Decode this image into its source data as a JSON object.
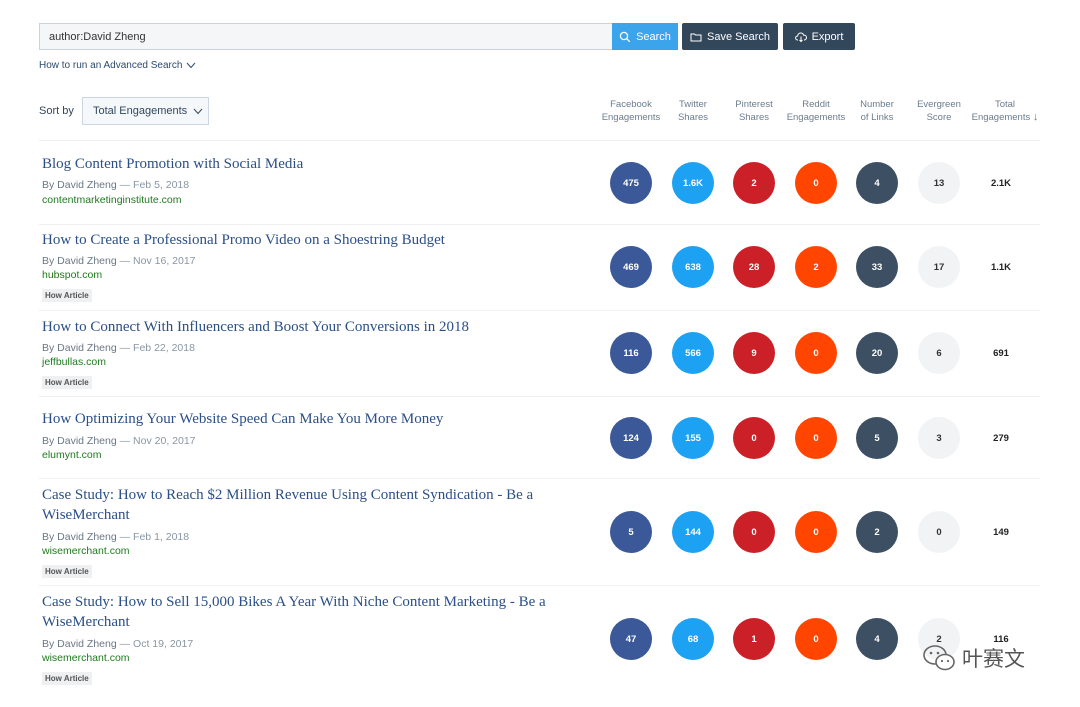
{
  "search": {
    "query": "author:David Zheng",
    "search_label": "Search",
    "save_label": "Save Search",
    "export_label": "Export",
    "advanced_link": "How to run an Advanced Search"
  },
  "sort": {
    "label": "Sort by",
    "selected": "Total Engagements"
  },
  "columns": [
    {
      "line1": "Facebook",
      "line2": "Engagements"
    },
    {
      "line1": "Twitter",
      "line2": "Shares"
    },
    {
      "line1": "Pinterest",
      "line2": "Shares"
    },
    {
      "line1": "Reddit",
      "line2": "Engagements"
    },
    {
      "line1": "Number",
      "line2": "of Links"
    },
    {
      "line1": "Evergreen",
      "line2": "Score"
    },
    {
      "line1": "Total",
      "line2": "Engagements",
      "sort_arrow": "↓"
    }
  ],
  "colors": {
    "facebook": "#3b5998",
    "twitter": "#1da1f2",
    "pinterest": "#cb2027",
    "reddit": "#ff4500",
    "links": "#3d4f63",
    "evergreen": "#f2f3f4"
  },
  "results": [
    {
      "title": "Blog Content Promotion with Social Media",
      "author": "By David Zheng",
      "date": "— Feb 5, 2018",
      "domain": "contentmarketinginstitute.com",
      "tag": "",
      "facebook": "475",
      "twitter": "1.6K",
      "pinterest": "2",
      "reddit": "0",
      "links": "4",
      "evergreen": "13",
      "total": "2.1K"
    },
    {
      "title": "How to Create a Professional Promo Video on a Shoestring Budget",
      "author": "By David Zheng",
      "date": "— Nov 16, 2017",
      "domain": "hubspot.com",
      "tag": "How Article",
      "facebook": "469",
      "twitter": "638",
      "pinterest": "28",
      "reddit": "2",
      "links": "33",
      "evergreen": "17",
      "total": "1.1K"
    },
    {
      "title": "How to Connect With Influencers and Boost Your Conversions in 2018",
      "author": "By David Zheng",
      "date": "— Feb 22, 2018",
      "domain": "jeffbullas.com",
      "tag": "How Article",
      "facebook": "116",
      "twitter": "566",
      "pinterest": "9",
      "reddit": "0",
      "links": "20",
      "evergreen": "6",
      "total": "691"
    },
    {
      "title": "How Optimizing Your Website Speed Can Make You More Money",
      "author": "By David Zheng",
      "date": "— Nov 20, 2017",
      "domain": "elumynt.com",
      "tag": "",
      "facebook": "124",
      "twitter": "155",
      "pinterest": "0",
      "reddit": "0",
      "links": "5",
      "evergreen": "3",
      "total": "279"
    },
    {
      "title": "Case Study: How to Reach $2 Million Revenue Using Content Syndication - Be a WiseMerchant",
      "author": "By David Zheng",
      "date": "— Feb 1, 2018",
      "domain": "wisemerchant.com",
      "tag": "How Article",
      "facebook": "5",
      "twitter": "144",
      "pinterest": "0",
      "reddit": "0",
      "links": "2",
      "evergreen": "0",
      "total": "149"
    },
    {
      "title": "Case Study: How to Sell 15,000 Bikes A Year With Niche Content Marketing - Be a WiseMerchant",
      "author": "By David Zheng",
      "date": "— Oct 19, 2017",
      "domain": "wisemerchant.com",
      "tag": "How Article",
      "facebook": "47",
      "twitter": "68",
      "pinterest": "1",
      "reddit": "0",
      "links": "4",
      "evergreen": "2",
      "total": "116"
    }
  ],
  "watermark": {
    "text": "叶赛文",
    "icon": "wechat-icon"
  }
}
